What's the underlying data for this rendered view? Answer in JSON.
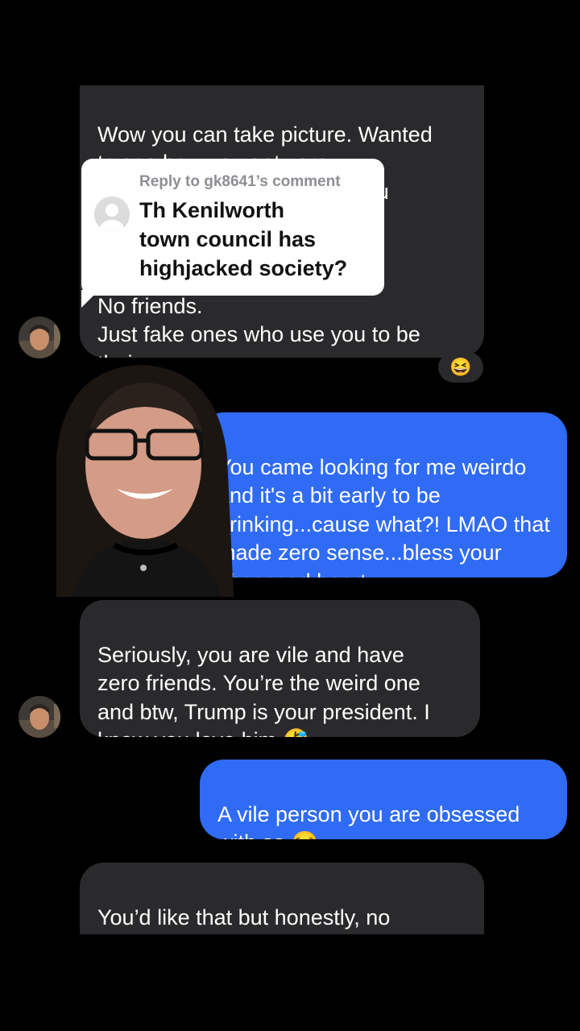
{
  "messages": [
    {
      "id": "m1",
      "side": "incoming",
      "text": "Wow you can take picture. Wanted\nto see how you get zero\ninteractions for the dribble you\npost. It's sad. You would get\nmore if you cared more\nabout style.\nNo friends.\nJust fake ones who use you to be\ntheir muse"
    },
    {
      "id": "m2",
      "side": "outgoing",
      "text": "You came looking for me weirdo\nand it's a bit early to be\ndrinking...cause what?! LMAO that\nmade zero sense...bless your\nobsessed heart"
    },
    {
      "id": "m3",
      "side": "incoming",
      "text": "Seriously, you are vile and have\nzero friends. You’re the weird one\nand btw, Trump is your president. I\nknow you love him 🤣"
    },
    {
      "id": "m4",
      "side": "outgoing",
      "text": "A vile person you are obsessed\nwith so 😒"
    },
    {
      "id": "m5",
      "side": "incoming",
      "text": "You’d like that but honestly, no\none is obsessed with you. You had"
    }
  ],
  "reaction": {
    "emoji": "😆"
  },
  "reply_card": {
    "header": "Reply to gk8641’s comment",
    "text": "Th Kenilworth\ntown council has\nhighjacked society?"
  },
  "colors": {
    "background": "#000000",
    "incoming_bubble": "#2a2a2c",
    "outgoing_bubble": "#2f6bf5",
    "reply_card": "#ffffff"
  },
  "icons": [
    "contact-avatar-icon",
    "reply-avatar-icon",
    "reaction-laugh-emoji"
  ]
}
